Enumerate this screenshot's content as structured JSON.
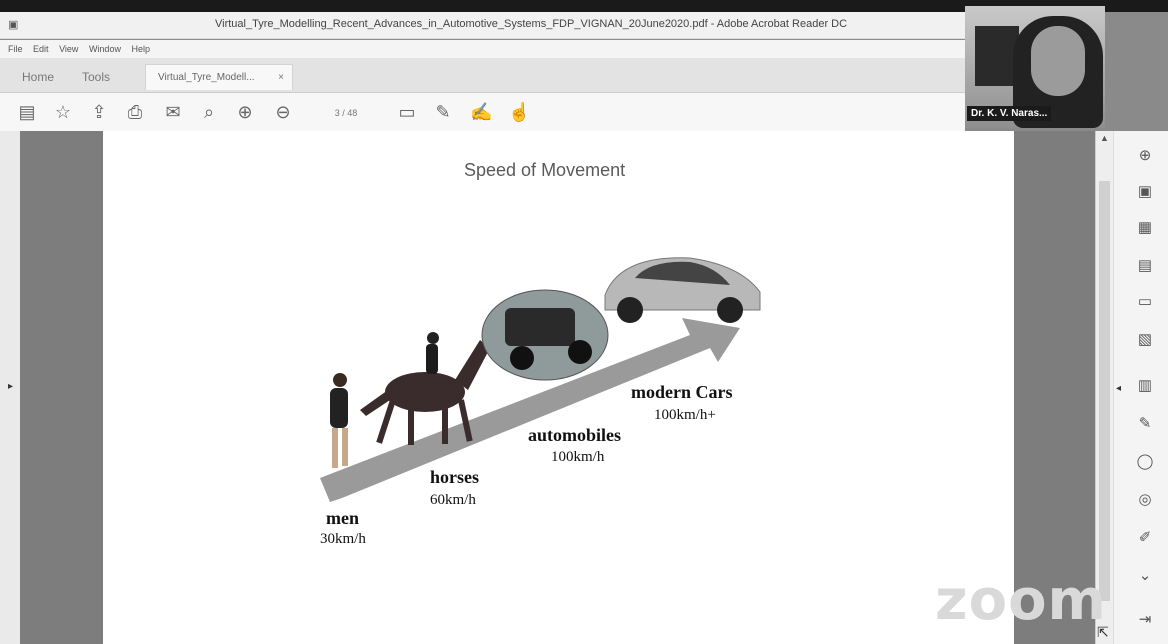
{
  "window": {
    "title": "Virtual_Tyre_Modelling_Recent_Advances_in_Automotive_Systems_FDP_VIGNAN_20June2020.pdf - Adobe Acrobat Reader DC",
    "menu": [
      "File",
      "Edit",
      "View",
      "Window",
      "Help"
    ]
  },
  "tabs": {
    "home": "Home",
    "tools": "Tools",
    "doc": "Virtual_Tyre_Modell...",
    "close": "×"
  },
  "toolbar": {
    "page_indicator": "3 / 48",
    "icons": [
      "save-icon",
      "bookmark-icon",
      "upload-icon",
      "print-icon",
      "email-icon",
      "zoom-out-icon",
      "page-up-icon",
      "page-down-icon",
      "comment-icon",
      "highlight-icon",
      "sign-icon",
      "stamp-icon"
    ]
  },
  "webcam": {
    "name": "Dr. K. V. Naras..."
  },
  "slide": {
    "title": "Speed of Movement",
    "stages": [
      {
        "name": "men",
        "speed": "30km/h"
      },
      {
        "name": "horses",
        "speed": "60km/h"
      },
      {
        "name": "automobiles",
        "speed": "100km/h"
      },
      {
        "name": "modern Cars",
        "speed": "100km/h+"
      }
    ]
  },
  "watermark": "zoom",
  "sidebar_icons": [
    "zoom-icon",
    "export-pdf-icon",
    "organize-icon",
    "create-pdf-icon",
    "comment-icon",
    "combine-icon",
    "compress-icon",
    "fill-sign-icon",
    "protect-icon",
    "optimize-icon",
    "edit-icon",
    "more-tools-icon",
    "collapse-icon"
  ]
}
